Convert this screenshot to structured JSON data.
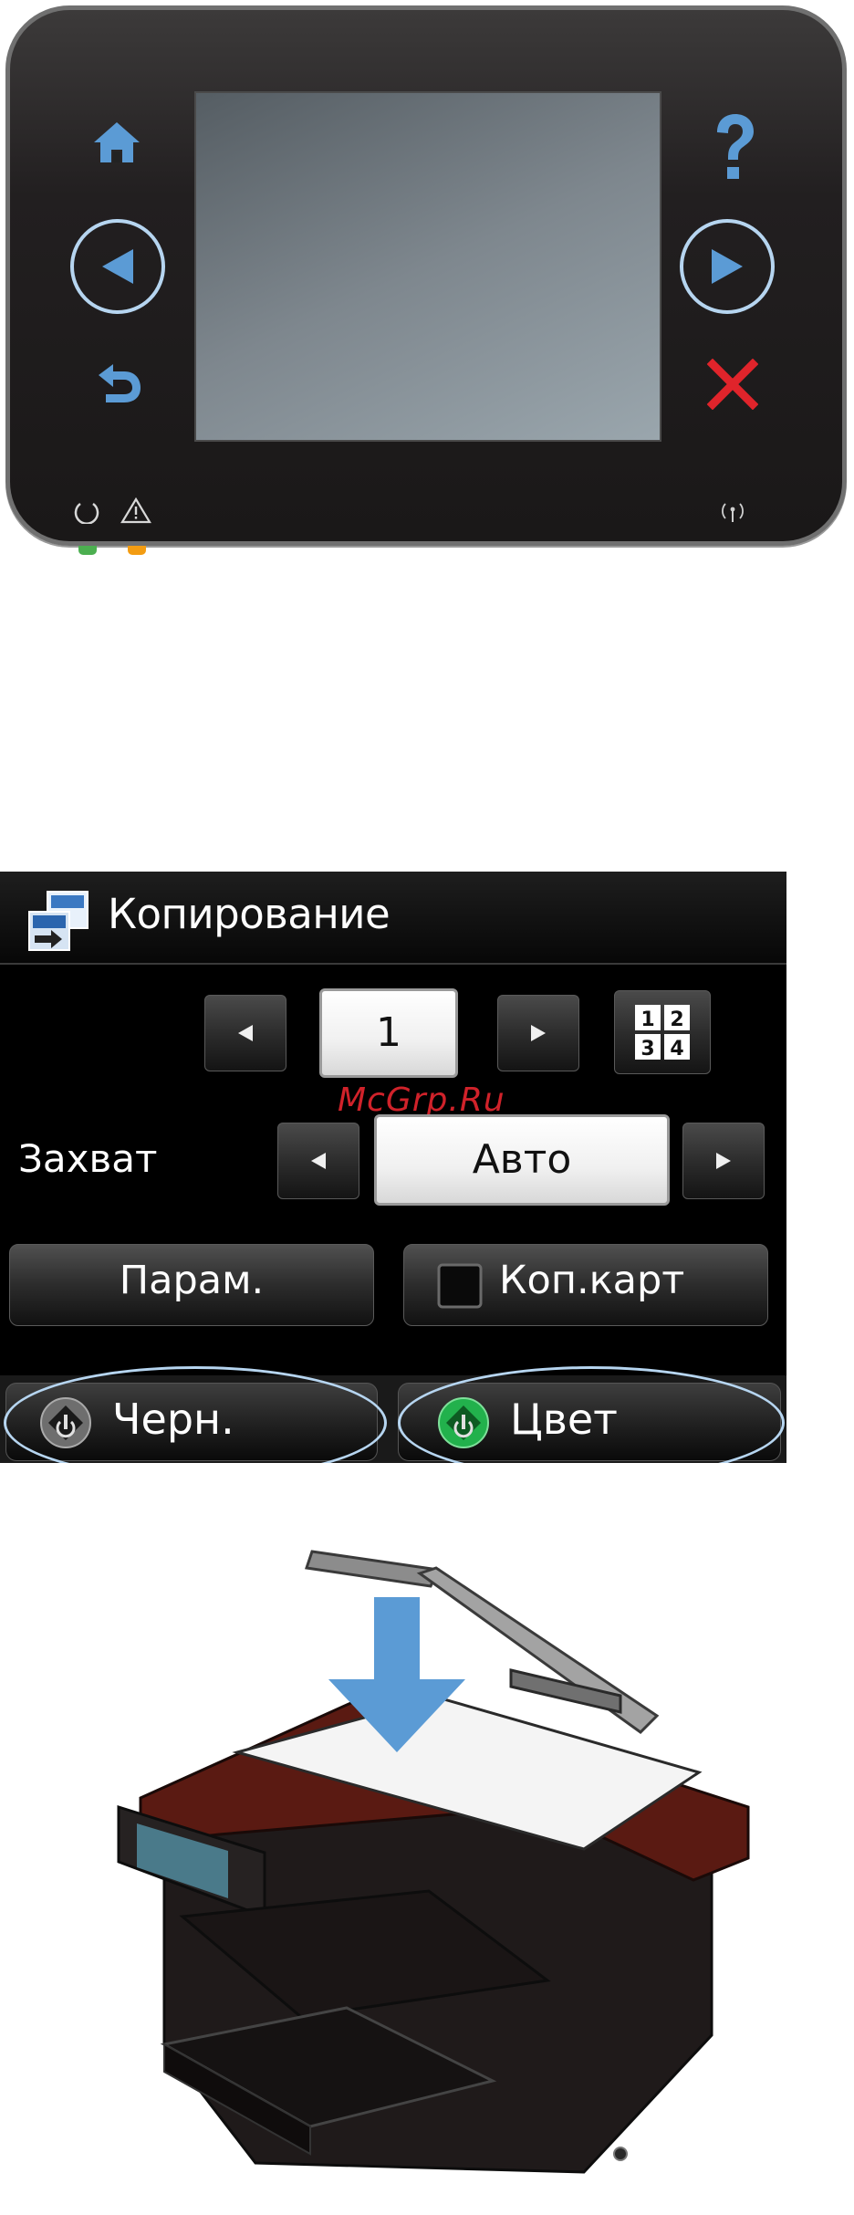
{
  "control_panel": {
    "icons": [
      "home-icon",
      "help-icon",
      "left-arrow-icon",
      "right-arrow-icon",
      "back-icon",
      "cancel-icon",
      "power-icon",
      "warning-icon",
      "wireless-icon"
    ],
    "colors": {
      "icon_blue": "#5b9bd5",
      "cancel_red": "#e0242b",
      "highlight_ring": "#b6d5f0",
      "ready_led": "#4caf50",
      "attention_led": "#f39c12"
    }
  },
  "touch_screen": {
    "title": "Копирование",
    "copies_value": "1",
    "capture_label": "Захват",
    "capture_value": "Авто",
    "settings_button": "Парам.",
    "id_copy_button": "Коп.карт",
    "black_start_button": "Черн.",
    "color_start_button": "Цвет",
    "layout_icon_digits": [
      "1",
      "2",
      "3",
      "4"
    ],
    "watermark": "McGrp.Ru"
  },
  "printer_illustration": {
    "arrow_color": "#5b9bd5",
    "body_color": "#1f1a1a",
    "accent_color": "#5a1a12"
  }
}
